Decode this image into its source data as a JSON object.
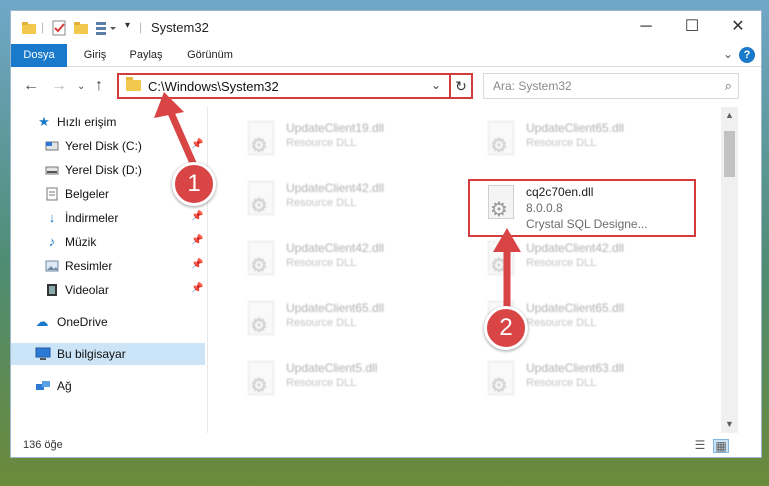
{
  "window": {
    "title": "System32",
    "controls": {
      "minimize": "─",
      "maximize": "☐",
      "close": "✕"
    }
  },
  "ribbon": {
    "tabs": [
      "Dosya",
      "Giriş",
      "Paylaş",
      "Görünüm"
    ],
    "help": "?"
  },
  "nav": {
    "address": "C:\\Windows\\System32",
    "search_placeholder": "Ara: System32"
  },
  "sidebar": {
    "quick_access": "Hızlı erişim",
    "items": [
      {
        "label": "Yerel Disk (C:)",
        "icon": "drive-icon",
        "pinned": true
      },
      {
        "label": "Yerel Disk (D:)",
        "icon": "drive-icon",
        "pinned": false
      },
      {
        "label": "Belgeler",
        "icon": "documents-icon",
        "pinned": true
      },
      {
        "label": "İndirmeler",
        "icon": "download-icon",
        "pinned": true
      },
      {
        "label": "Müzik",
        "icon": "music-icon",
        "pinned": true
      },
      {
        "label": "Resimler",
        "icon": "pictures-icon",
        "pinned": true
      },
      {
        "label": "Videolar",
        "icon": "video-icon",
        "pinned": true
      }
    ],
    "onedrive": "OneDrive",
    "this_pc": "Bu bilgisayar",
    "network": "Ağ"
  },
  "files": {
    "left": [
      {
        "name": "UpdateClient19.dll",
        "type": "Resource DLL"
      },
      {
        "name": "UpdateClient42.dll",
        "type": "Resource DLL"
      },
      {
        "name": "UpdateClient42.dll",
        "type": "Resource DLL"
      },
      {
        "name": "UpdateClient65.dll",
        "type": "Resource DLL"
      },
      {
        "name": "UpdateClient5.dll",
        "type": "Resource DLL"
      }
    ],
    "right": [
      {
        "name": "UpdateClient65.dll",
        "type": "Resource DLL"
      },
      {
        "name": "UpdateClient42.dll",
        "type": "Resource DLL"
      },
      {
        "name": "UpdateClient65.dll",
        "type": "Resource DLL"
      },
      {
        "name": "UpdateClient63.dll",
        "type": "Resource DLL"
      }
    ],
    "highlighted": {
      "name": "cq2c70en.dll",
      "version": "8.0.0.8",
      "description": "Crystal SQL Designe..."
    }
  },
  "status": {
    "item_count": "136 öğe"
  },
  "callouts": {
    "step1": "1",
    "step2": "2"
  },
  "colors": {
    "accent": "#1979ca",
    "callout": "#d94545",
    "selection": "#cce4f7"
  }
}
